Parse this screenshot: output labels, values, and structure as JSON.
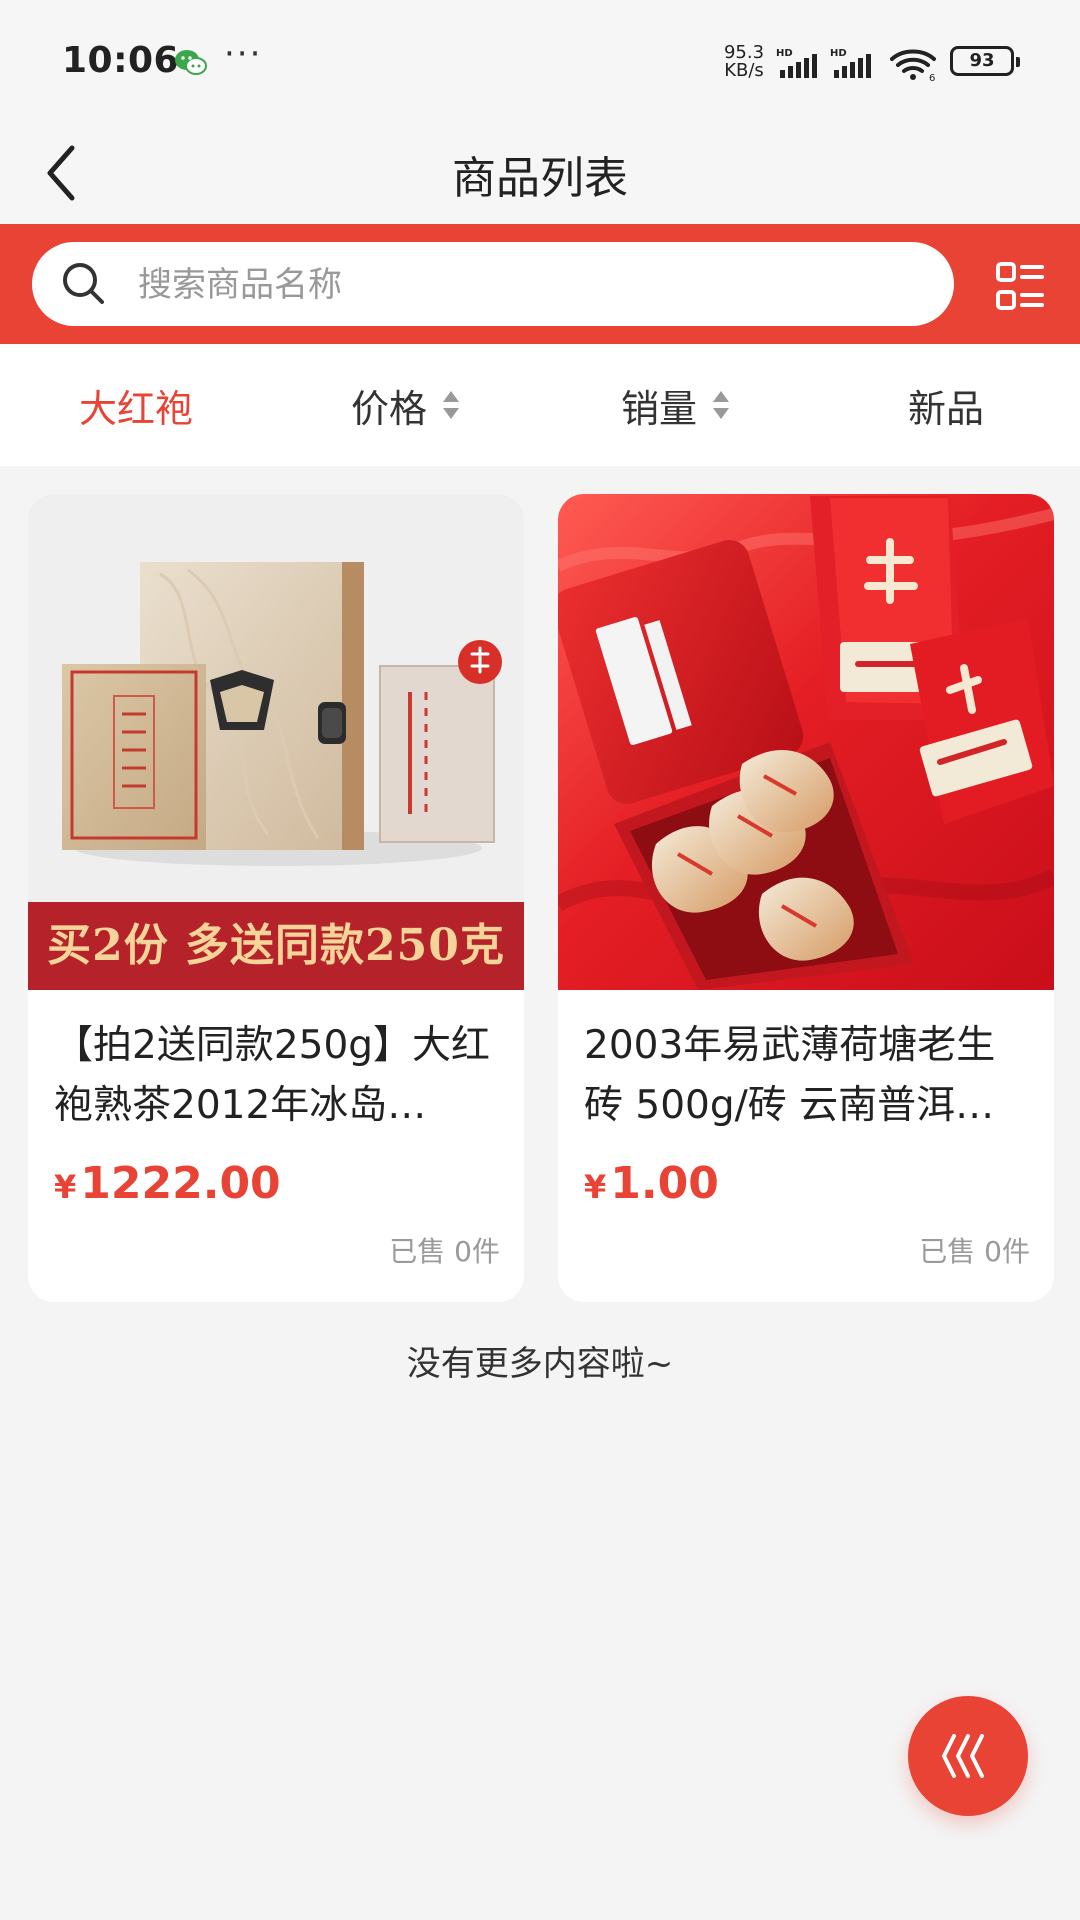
{
  "status_bar": {
    "time": "10:06",
    "net_speed_value": "95.3",
    "net_speed_unit": "KB/s",
    "battery": "93",
    "icons": [
      "wechat-icon",
      "signal-icon",
      "signal-icon",
      "wifi-icon",
      "battery-icon"
    ]
  },
  "header": {
    "title": "商品列表",
    "back_icon": "chevron-left-icon"
  },
  "search": {
    "placeholder": "搜索商品名称",
    "value": "",
    "search_icon": "search-icon",
    "layout_icon": "layout-toggle-icon"
  },
  "filters": {
    "tabs": [
      {
        "label": "大红袍",
        "active": true
      },
      {
        "label": "价格",
        "sortable": true
      },
      {
        "label": "销量",
        "sortable": true
      },
      {
        "label": "新品"
      }
    ]
  },
  "products": [
    {
      "promo_banner": "买2份  多送同款250克",
      "title": "【拍2送同款250g】大红袍熟茶2012年冰岛…",
      "currency": "¥",
      "price": "1222.00",
      "sold": "已售 0件"
    },
    {
      "title": "2003年易武薄荷塘老生砖 500g/砖 云南普洱…",
      "currency": "¥",
      "price": "1.00",
      "sold": "已售 0件"
    }
  ],
  "footer": {
    "end_message": "没有更多内容啦~",
    "float_button_icon": "back-to-top-icon"
  },
  "colors": {
    "accent": "#e84335",
    "promo_banner": "#b5222a",
    "promo_text": "#f5d49a"
  }
}
